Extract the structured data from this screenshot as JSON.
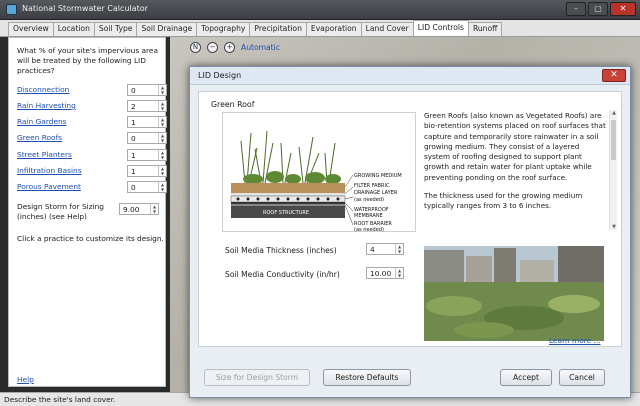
{
  "window": {
    "title": "National Stormwater Calculator"
  },
  "tabs": [
    "Overview",
    "Location",
    "Soil Type",
    "Soil Drainage",
    "Topography",
    "Precipitation",
    "Evaporation",
    "Land Cover",
    "LID Controls",
    "Runoff"
  ],
  "active_tab": "LID Controls",
  "left_panel": {
    "intro": "What % of your site's impervious area will be treated by the following LID practices?",
    "practices": [
      {
        "label": "Disconnection",
        "value": "0"
      },
      {
        "label": "Rain Harvesting",
        "value": "2"
      },
      {
        "label": "Rain Gardens",
        "value": "1"
      },
      {
        "label": "Green Roofs",
        "value": "0"
      },
      {
        "label": "Street Planters",
        "value": "1"
      },
      {
        "label": "Infiltration Basins",
        "value": "1"
      },
      {
        "label": "Porous Pavement",
        "value": "0"
      }
    ],
    "storm_label": "Design Storm for Sizing (inches) (see Help)",
    "storm_value": "9.00",
    "hint": "Click a practice to customize its design.",
    "help": "Help"
  },
  "map_toolbar": {
    "auto_label": "Automatic"
  },
  "status": {
    "text": "Describe the site's land cover."
  },
  "dialog": {
    "title": "LID Design",
    "section": "Green Roof",
    "diagram_labels": {
      "growing_medium": "GROWING MEDIUM",
      "filter": "FILTER FABRIC",
      "drainage": "DRAINAGE LAYER",
      "drainage_note": "(as needed)",
      "waterproof": "WATERPROOF",
      "membrane": "MEMBRANE",
      "root": "ROOT BARRIER",
      "root_note": "(as needed)",
      "roof": "ROOF STRUCTURE"
    },
    "description_1": "Green Roofs (also known as Vegetated Roofs) are bio-retention systems placed on roof surfaces that capture and temporarily store rainwater in a soil growing medium. They consist of a layered system of roofing designed to support plant growth and retain water for plant uptake while preventing ponding on the roof surface.",
    "description_2": "The thickness used for the growing medium typically ranges from 3 to 6 inches.",
    "thickness_label": "Soil Media Thickness (inches)",
    "thickness_value": "4",
    "conductivity_label": "Soil Media Conductivity (in/hr)",
    "conductivity_value": "10.00",
    "learn_more": "Learn more ...",
    "buttons": {
      "size": "Size for Design Storm",
      "restore": "Restore Defaults",
      "accept": "Accept",
      "cancel": "Cancel"
    }
  },
  "colors": {
    "link": "#1d4fb0",
    "titlebar": "#45484c",
    "dialog_bg": "#e9eef5"
  },
  "icons": [
    "app-icon",
    "minimize-icon",
    "maximize-icon",
    "close-icon",
    "compass-icon",
    "zoom-out-icon",
    "zoom-in-icon",
    "spinner-up-icon",
    "spinner-down-icon"
  ]
}
